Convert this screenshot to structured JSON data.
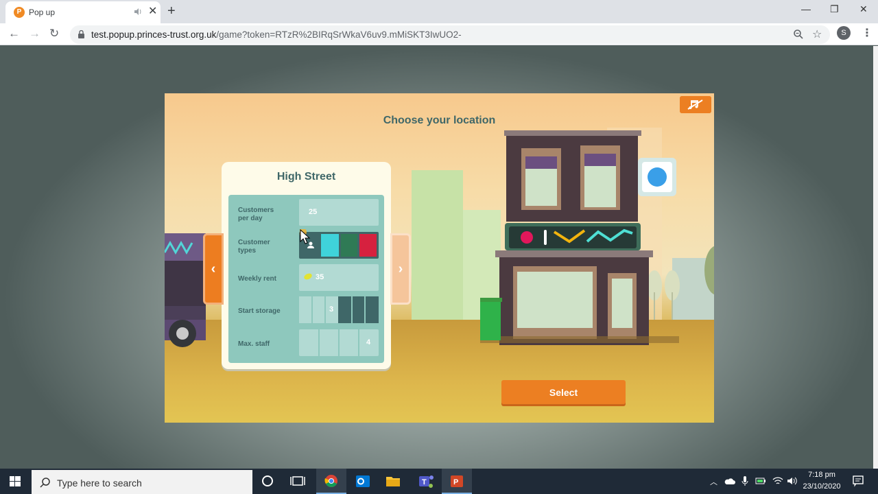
{
  "browser": {
    "tab_title": "Pop up",
    "tab_favicon_letter": "P",
    "url_host": "test.popup.princes-trust.org.uk",
    "url_path": "/game?token=RTzR%2BIRqSrWkaV6uv9.mMiSKT3IwUO2-",
    "profile_initial": "S",
    "icons": [
      "back-icon",
      "forward-icon",
      "reload-icon",
      "lock-icon",
      "zoom-icon",
      "star-icon",
      "menu-icon",
      "audio-icon",
      "close-icon",
      "new-tab-icon"
    ]
  },
  "game": {
    "title": "Choose your location",
    "location": {
      "name": "High Street",
      "stats": [
        {
          "label_line1": "Customers",
          "label_line2": "per day",
          "value": "25"
        },
        {
          "label_line1": "Customer",
          "label_line2": "types",
          "value": ""
        },
        {
          "label_line1": "Weekly rent",
          "label_line2": "",
          "value": "35"
        },
        {
          "label_line1": "Start storage",
          "label_line2": "",
          "value": "3"
        },
        {
          "label_line1": "Max. staff",
          "label_line2": "",
          "value": "4"
        }
      ],
      "customer_type_colors": [
        "#3fd3da",
        "#2f7a55",
        "#d6213f"
      ]
    },
    "select_label": "Select",
    "colors": {
      "accent_orange": "#ec7f22",
      "heading_teal": "#3f6768",
      "card_bg": "#fefbe9",
      "stats_bg": "#8ec8bd"
    }
  },
  "taskbar": {
    "search_placeholder": "Type here to search",
    "time": "7:18 pm",
    "date": "23/10/2020",
    "apps": [
      "cortana-icon",
      "task-view-icon",
      "chrome-icon",
      "outlook-icon",
      "file-explorer-icon",
      "teams-icon",
      "powerpoint-icon"
    ]
  }
}
